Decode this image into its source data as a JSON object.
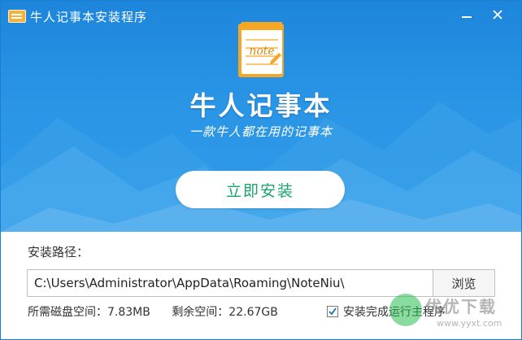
{
  "window": {
    "title": "牛人记事本安装程序",
    "minimize_icon": "minimize-icon",
    "close_icon": "close-icon"
  },
  "brand": {
    "logo_word": "note",
    "name": "牛人记事本",
    "slogan": "一款牛人都在用的记事本"
  },
  "install": {
    "button_label": "立即安装"
  },
  "path": {
    "label": "安装路径：",
    "value": "C:\\Users\\Administrator\\AppData\\Roaming\\NoteNiu\\",
    "browse_label": "浏览"
  },
  "space": {
    "required": "所需磁盘空间：7.83MB",
    "free": "剩余空间：22.67GB"
  },
  "option": {
    "run_after_install_label": "安装完成运行主程序",
    "run_after_install_checked": true
  },
  "watermark": {
    "text": "优优下载",
    "url": "www.yyxt.com"
  },
  "colors": {
    "header_blue": "#2a95e5",
    "install_text_green": "#1aa468",
    "note_orange": "#f5a623"
  }
}
